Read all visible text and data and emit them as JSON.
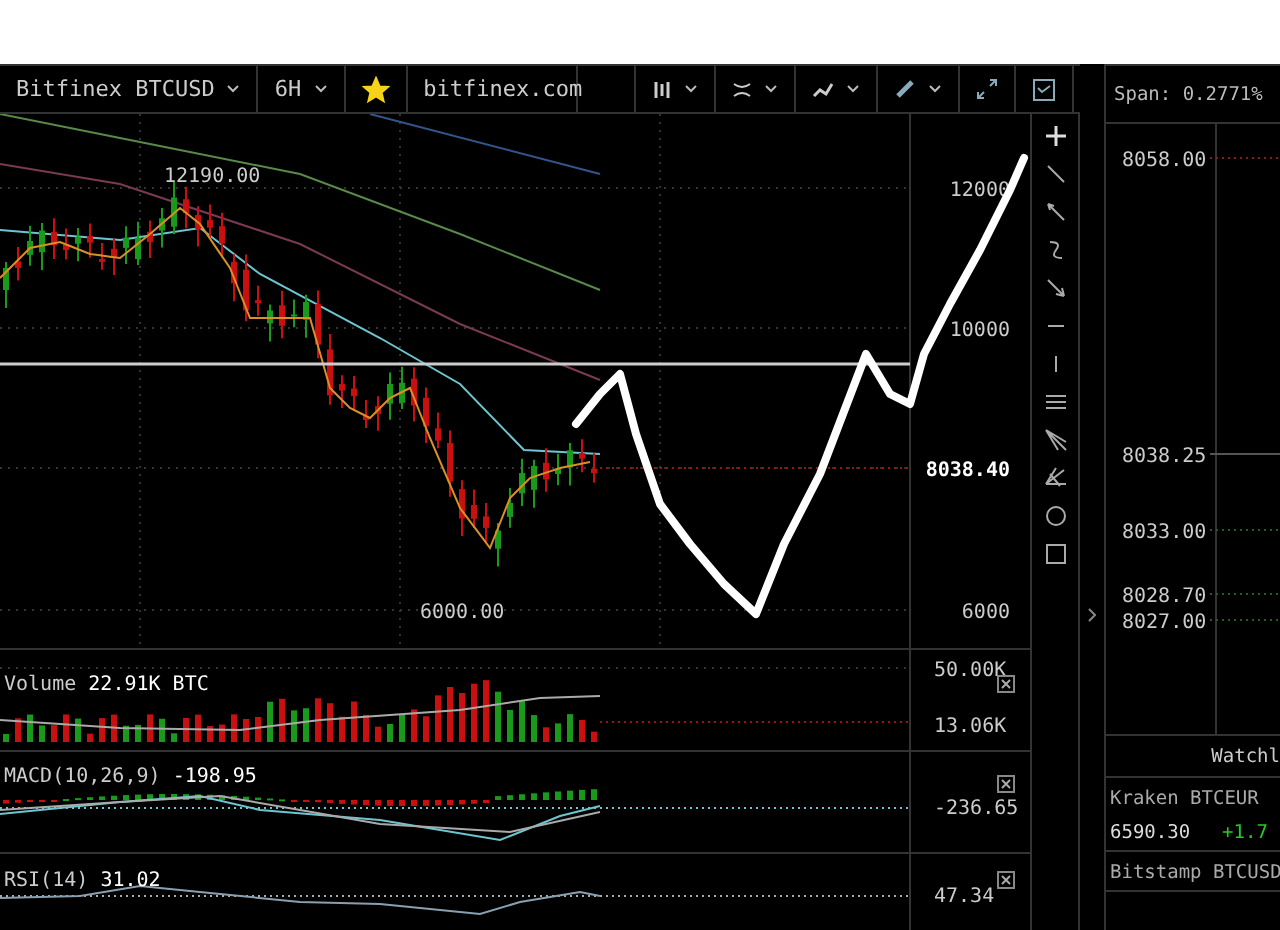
{
  "toolbar": {
    "symbol": "Bitfinex BTCUSD",
    "interval": "6H",
    "favorite": true,
    "site": "bitfinex.com"
  },
  "main_chart": {
    "price_labels": [
      "12000",
      "10000",
      "8038.40",
      "6000"
    ],
    "high_label": "12190.00",
    "low_label": "6000.00"
  },
  "indicators": [
    {
      "kind": "volume",
      "title": "Volume",
      "value": "22.91K BTC",
      "axis_labels": [
        "50.00K",
        "13.06K"
      ]
    },
    {
      "kind": "macd",
      "title": "MACD(10,26,9)",
      "value": "-198.95",
      "axis_labels": [
        "-236.65"
      ]
    },
    {
      "kind": "rsi",
      "title": "RSI(14)",
      "value": "31.02",
      "axis_labels": [
        "47.34"
      ]
    }
  ],
  "order_book": {
    "span": "Span: 0.2771%",
    "prices": [
      "8058.00",
      "8038.25",
      "8033.00",
      "8028.70",
      "8027.00"
    ]
  },
  "watchlist": {
    "title": "Watchl",
    "items": [
      {
        "name": "Kraken BTCEUR",
        "price": "6590.30",
        "change": "+1.7"
      },
      {
        "name": "Bitstamp BTCUSD"
      }
    ]
  }
}
